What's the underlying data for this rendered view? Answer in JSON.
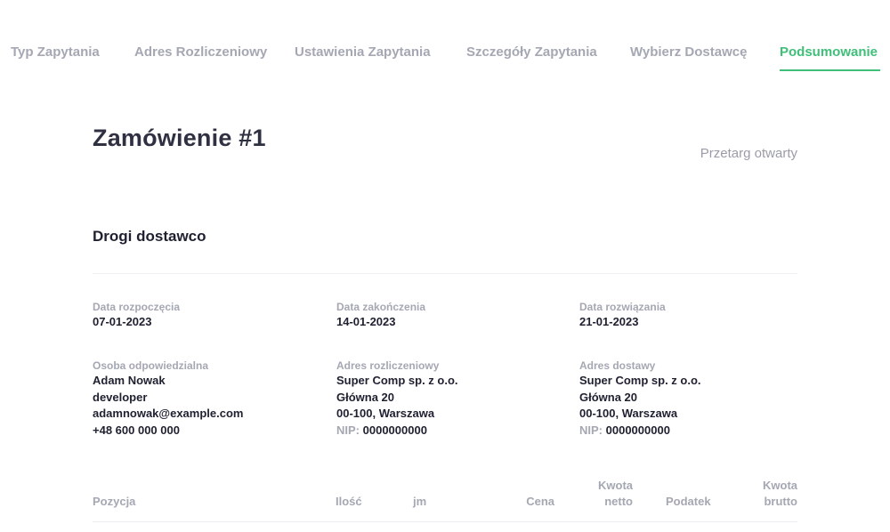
{
  "tabs": [
    {
      "label": "Typ Zapytania",
      "active": false
    },
    {
      "label": "Adres Rozliczeniowy",
      "active": false
    },
    {
      "label": "Ustawienia Zapytania",
      "active": false
    },
    {
      "label": "Szczegóły Zapytania",
      "active": false
    },
    {
      "label": "Wybierz Dostawcę",
      "active": false
    },
    {
      "label": "Podsumowanie",
      "active": true
    }
  ],
  "order": {
    "title": "Zamówienie #1",
    "type": "Przetarg otwarty",
    "greeting": "Drogi dostawco"
  },
  "dates": {
    "start": {
      "label": "Data rozpoczęcia",
      "value": "07-01-2023"
    },
    "end": {
      "label": "Data zakończenia",
      "value": "14-01-2023"
    },
    "resolution": {
      "label": "Data rozwiązania",
      "value": "21-01-2023"
    }
  },
  "responsible": {
    "label": "Osoba odpowiedzialna",
    "name": "Adam Nowak",
    "role": "developer",
    "email": "adamnowak@example.com",
    "phone": "+48 600 000 000"
  },
  "billing": {
    "label": "Adres rozliczeniowy",
    "company": "Super Comp sp. z o.o.",
    "street": "Główna 20",
    "city": "00-100, Warszawa",
    "nip_label": "NIP:",
    "nip": "0000000000"
  },
  "delivery": {
    "label": "Adres dostawy",
    "company": "Super Comp sp. z o.o.",
    "street": "Główna 20",
    "city": "00-100, Warszawa",
    "nip_label": "NIP:",
    "nip": "0000000000"
  },
  "table": {
    "columns": {
      "position": "Pozycja",
      "quantity": "Ilość",
      "unit": "jm",
      "price": "Cena",
      "net_line1": "Kwota",
      "net_line2": "netto",
      "tax": "Podatek",
      "gross_line1": "Kwota",
      "gross_line2": "brutto"
    }
  }
}
